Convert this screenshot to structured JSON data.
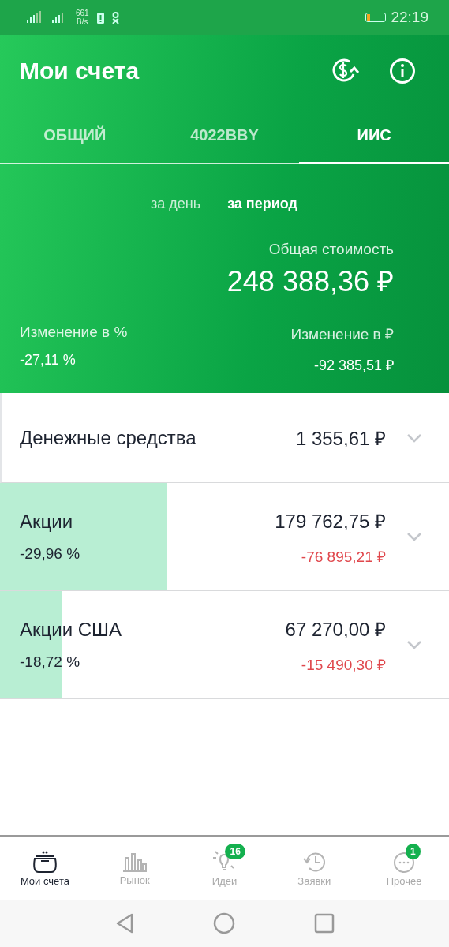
{
  "status_bar": {
    "speed_value": "661",
    "speed_unit": "B/s",
    "time": "22:19"
  },
  "header": {
    "title": "Мои счета"
  },
  "tabs": [
    {
      "label": "ОБЩИЙ",
      "selected": false
    },
    {
      "label": "4022BBY",
      "selected": false
    },
    {
      "label": "ИИС",
      "selected": true
    }
  ],
  "summary": {
    "periods": [
      {
        "label": "за день",
        "selected": false
      },
      {
        "label": "за период",
        "selected": true
      }
    ],
    "total_label": "Общая стоимость",
    "total_value": "248 388,36 ₽",
    "change_pct_label": "Изменение в  %",
    "change_pct_value": "-27,11  %",
    "change_rub_label": "Изменение в ₽",
    "change_rub_value": "-92 385,51 ₽"
  },
  "assets": [
    {
      "kind": "cash",
      "name": "Денежные средства",
      "value": "1 355,61 ₽"
    },
    {
      "kind": "asset",
      "name": "Акции",
      "percent": "-29,96  %",
      "value": "179 762,75 ₽",
      "change": "-76 895,21 ₽",
      "level": 0.373
    },
    {
      "kind": "asset",
      "name": "Акции США",
      "percent": "-18,72  %",
      "value": "67 270,00 ₽",
      "change": "-15 490,30 ₽",
      "level": 0.139
    }
  ],
  "bottom_nav": [
    {
      "label": "Мои счета",
      "selected": true
    },
    {
      "label": "Рынок",
      "selected": false
    },
    {
      "label": "Идеи",
      "selected": false,
      "badge": "16"
    },
    {
      "label": "Заявки",
      "selected": false
    },
    {
      "label": "Прочее",
      "selected": false,
      "badge": "1"
    }
  ]
}
